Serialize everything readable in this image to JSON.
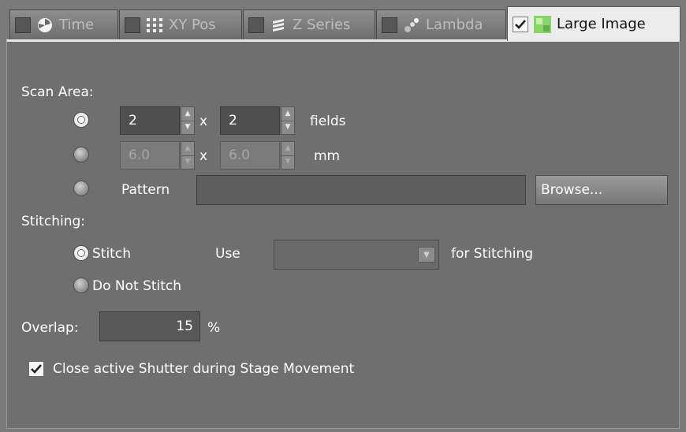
{
  "tabs": [
    {
      "label": "Time",
      "icon": "clock-icon",
      "checked": false
    },
    {
      "label": "XY Pos",
      "icon": "grid-dots-icon",
      "checked": false
    },
    {
      "label": "Z Series",
      "icon": "layers-icon",
      "checked": false
    },
    {
      "label": "Lambda",
      "icon": "spectrum-icon",
      "checked": false
    },
    {
      "label": "Large Image",
      "icon": "large-image-icon",
      "checked": true
    }
  ],
  "scan_area": {
    "label": "Scan Area:",
    "fields_x": "2",
    "fields_y": "2",
    "fields_unit": "fields",
    "times": "x",
    "mm_x": "6.0",
    "mm_y": "6.0",
    "mm_unit": "mm",
    "pattern_label": "Pattern",
    "pattern_value": "",
    "browse_label": "Browse..."
  },
  "stitching": {
    "label": "Stitching:",
    "stitch_label": "Stitch",
    "no_stitch_label": "Do Not Stitch",
    "use_label": "Use",
    "use_value": "",
    "for_label": "for Stitching"
  },
  "overlap": {
    "label": "Overlap:",
    "value": "15",
    "unit": "%"
  },
  "shutter": {
    "label": "Close active Shutter during Stage Movement",
    "checked": true
  },
  "colors": {
    "panel": "#6f6f6f",
    "active_tab": "#ececec",
    "text": "#ffffff"
  }
}
